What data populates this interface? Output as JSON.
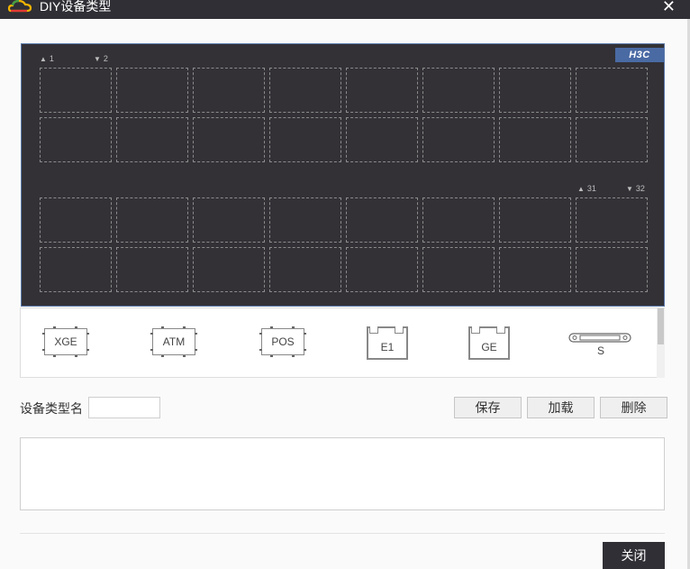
{
  "window": {
    "title": "DIY设备类型",
    "close_glyph": "✕"
  },
  "panel": {
    "brand": "H3C",
    "port_labels": {
      "top_left_1": "1",
      "top_left_2": "2",
      "right_31": "31",
      "right_32": "32"
    }
  },
  "modules": [
    {
      "name": "xge-module",
      "label": "XGE",
      "icon": "transceiver-icon"
    },
    {
      "name": "atm-module",
      "label": "ATM",
      "icon": "transceiver-icon"
    },
    {
      "name": "pos-module",
      "label": "POS",
      "icon": "transceiver-icon"
    },
    {
      "name": "e1-module",
      "label": "E1",
      "icon": "ethernet-port-icon"
    },
    {
      "name": "ge-module",
      "label": "GE",
      "icon": "ethernet-port-icon"
    },
    {
      "name": "s-module",
      "label": "S",
      "icon": "serial-port-icon"
    }
  ],
  "form": {
    "device_type_label": "设备类型名",
    "device_type_value": "",
    "save_label": "保存",
    "load_label": "加载",
    "delete_label": "删除",
    "close_label": "关闭"
  },
  "colors": {
    "titlebar": "#2f2f35",
    "panel": "#333136",
    "brand": "#4a6aa4"
  }
}
